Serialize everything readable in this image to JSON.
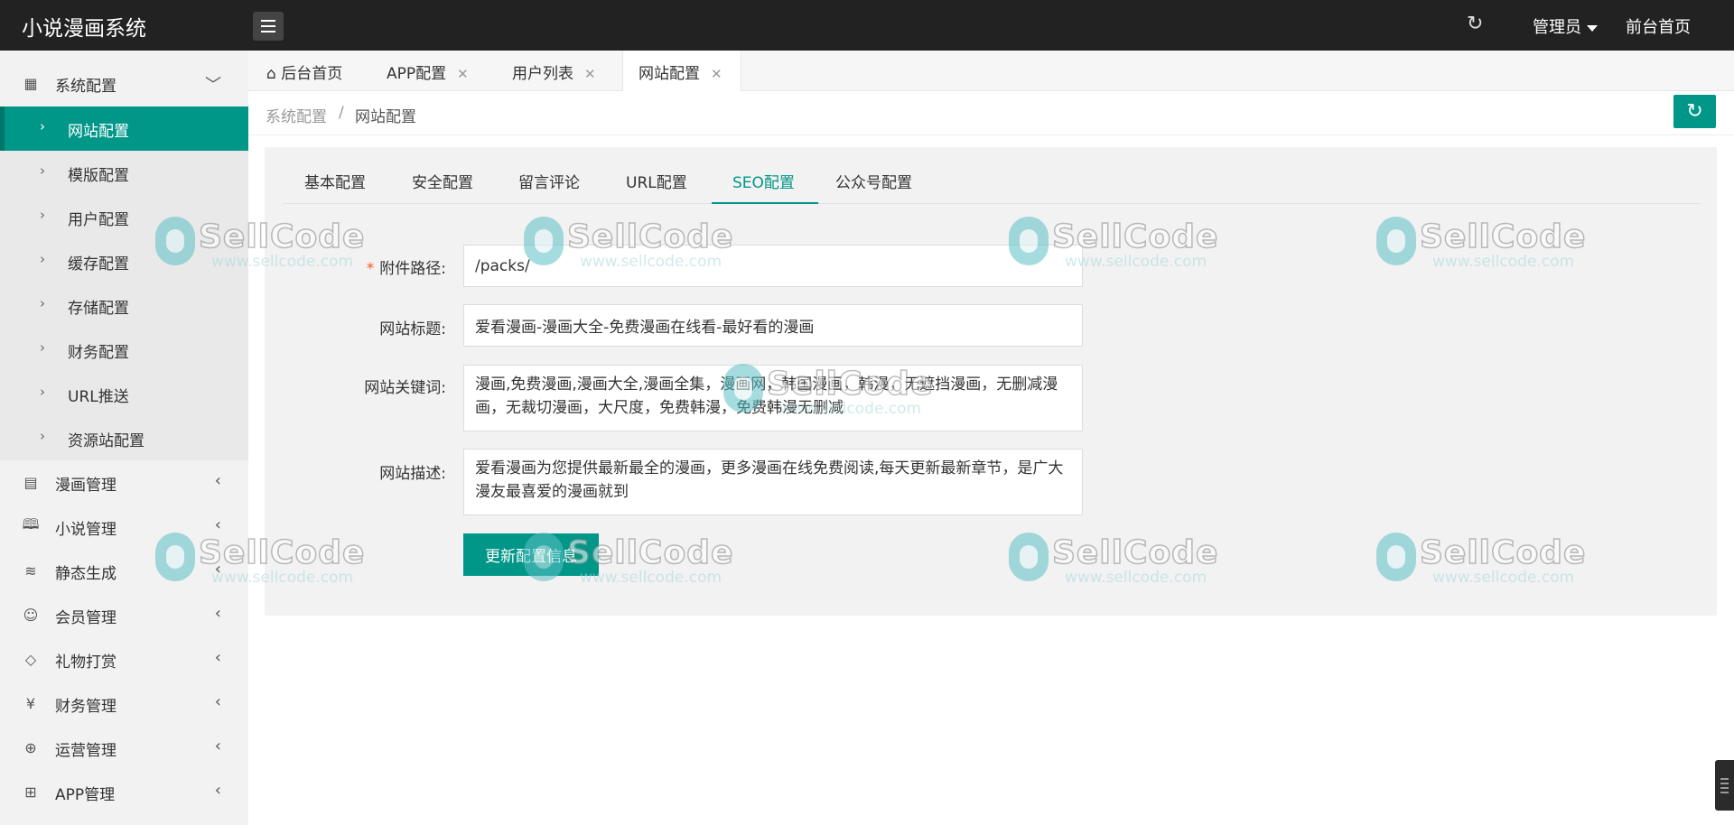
{
  "header": {
    "app_title": "小说漫画系统",
    "admin_label": "管理员",
    "frontend_link": "前台首页"
  },
  "sidebar": {
    "groups": [
      {
        "label": "系统配置",
        "icon": "grid-icon",
        "expanded": true
      },
      {
        "label": "漫画管理",
        "icon": "book-icon"
      },
      {
        "label": "小说管理",
        "icon": "open-book-icon"
      },
      {
        "label": "静态生成",
        "icon": "layers-icon"
      },
      {
        "label": "会员管理",
        "icon": "user-icon"
      },
      {
        "label": "礼物打赏",
        "icon": "diamond-icon"
      },
      {
        "label": "财务管理",
        "icon": "yen-icon"
      },
      {
        "label": "运营管理",
        "icon": "globe-icon"
      },
      {
        "label": "APP管理",
        "icon": "windows-icon"
      }
    ],
    "sub_items": [
      {
        "label": "网站配置",
        "active": true
      },
      {
        "label": "模版配置"
      },
      {
        "label": "用户配置"
      },
      {
        "label": "缓存配置"
      },
      {
        "label": "存储配置"
      },
      {
        "label": "财务配置"
      },
      {
        "label": "URL推送"
      },
      {
        "label": "资源站配置"
      }
    ]
  },
  "tabs": [
    {
      "label": "后台首页",
      "icon": "home-icon"
    },
    {
      "label": "APP配置",
      "close": "✕"
    },
    {
      "label": "用户列表",
      "close": "✕"
    },
    {
      "label": "网站配置",
      "close": "✕",
      "active": true
    }
  ],
  "breadcrumb": {
    "parent": "系统配置",
    "separator": "/",
    "current": "网站配置"
  },
  "config_tabs": [
    "基本配置",
    "安全配置",
    "留言评论",
    "URL配置",
    "SEO配置",
    "公众号配置"
  ],
  "active_config_tab": "SEO配置",
  "form": {
    "attachment_path": {
      "label": "附件路径:",
      "required_mark": "*",
      "value": "/packs/"
    },
    "site_title": {
      "label": "网站标题:",
      "value": "爱看漫画-漫画大全-免费漫画在线看-最好看的漫画"
    },
    "site_keywords": {
      "label": "网站关键词:",
      "value": "漫画,免费漫画,漫画大全,漫画全集，漫画网，韩国漫画，韩漫，无遮挡漫画，无删减漫画，无裁切漫画，大尺度，免费韩漫，免费韩漫无删减"
    },
    "site_description": {
      "label": "网站描述:",
      "value": "爱看漫画为您提供最新最全的漫画，更多漫画在线免费阅读,每天更新最新章节，是广大漫友最喜爱的漫画就到"
    },
    "submit_label": "更新配置信息"
  },
  "watermark": {
    "brand": "SellCode",
    "url": "www.sellcode.com"
  },
  "colors": {
    "accent": "#009688",
    "header_bg": "#222222",
    "sidebar_bg": "#f2f2f2"
  }
}
